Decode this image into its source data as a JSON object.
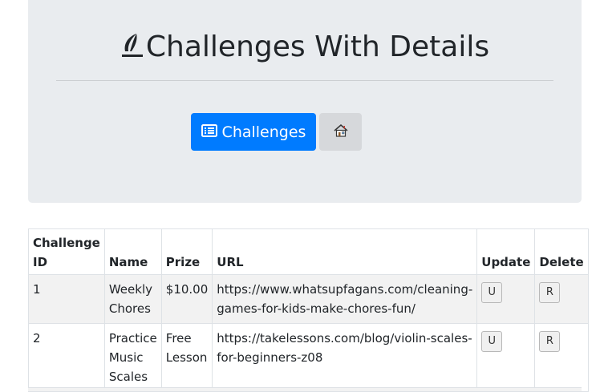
{
  "header": {
    "title": "Challenges With Details",
    "challenges_button": "Challenges",
    "home_button_icon": "house-icon"
  },
  "table": {
    "headers": {
      "id": "Challenge ID",
      "name": "Name",
      "prize": "Prize",
      "url": "URL",
      "update": "Update",
      "delete": "Delete"
    },
    "rows": [
      {
        "id": "1",
        "name": "Weekly Chores",
        "prize": "$10.00",
        "url": "https://www.whatsupfagans.com/cleaning-games-for-kids-make-chores-fun/",
        "update": "U",
        "delete": "R"
      },
      {
        "id": "2",
        "name": "Practice Music Scales",
        "prize": "Free Lesson",
        "url": "https://takelessons.com/blog/violin-scales-for-beginners-z08",
        "update": "U",
        "delete": "R"
      }
    ]
  },
  "colors": {
    "primary": "#007bff",
    "jumbotron": "#e9ecef",
    "stripe": "#f2f2f2"
  }
}
